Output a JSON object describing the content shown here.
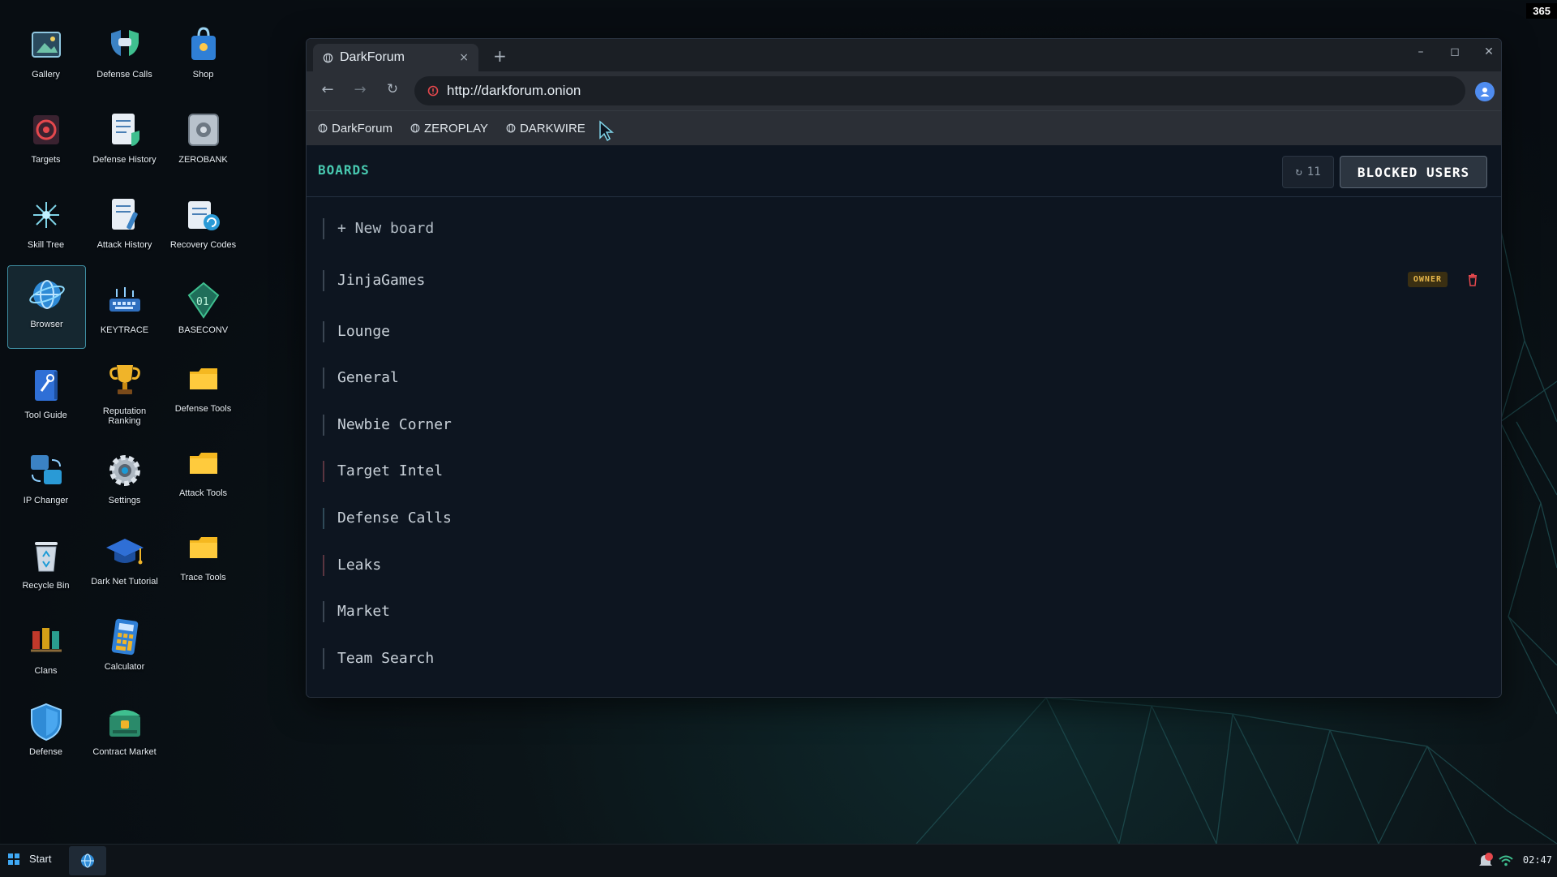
{
  "corner_badge": "365",
  "desktop_icons": [
    {
      "label": "Gallery"
    },
    {
      "label": "Defense Calls"
    },
    {
      "label": "Shop"
    },
    {
      "label": "Targets"
    },
    {
      "label": "Defense History"
    },
    {
      "label": "ZEROBANK"
    },
    {
      "label": "Skill Tree"
    },
    {
      "label": "Attack History"
    },
    {
      "label": "Recovery Codes"
    },
    {
      "label": "Browser"
    },
    {
      "label": "KEYTRACE"
    },
    {
      "label": "BASECONV"
    },
    {
      "label": "Tool Guide"
    },
    {
      "label": "Reputation Ranking"
    },
    {
      "label": "Defense Tools"
    },
    {
      "label": "IP Changer"
    },
    {
      "label": "Settings"
    },
    {
      "label": "Attack Tools"
    },
    {
      "label": "Recycle Bin"
    },
    {
      "label": "Dark Net Tutorial"
    },
    {
      "label": "Trace Tools"
    },
    {
      "label": "Clans"
    },
    {
      "label": "Calculator"
    },
    {
      "label": "Defense"
    },
    {
      "label": "Contract Market"
    }
  ],
  "browser": {
    "tab_title": "DarkForum",
    "tab_close": "×",
    "new_tab": "+",
    "url": "http://darkforum.onion",
    "bookmarks": [
      "DarkForum",
      "ZEROPLAY",
      "DARKWIRE"
    ]
  },
  "page": {
    "title": "BOARDS",
    "refresh_count": "11",
    "blocked_users_label": "BLOCKED USERS",
    "new_board_label": "+ New board",
    "boards": [
      "JinjaGames",
      "Lounge",
      "General",
      "Newbie Corner",
      "Target Intel",
      "Defense Calls",
      "Leaks",
      "Market",
      "Team Search"
    ],
    "owner_badge": "OWNER"
  },
  "taskbar": {
    "start_label": "Start",
    "clock": "02:47"
  },
  "colors": {
    "accent": "#48c9b0",
    "owner_badge": "#e8b84b",
    "delete": "#e5484d"
  }
}
